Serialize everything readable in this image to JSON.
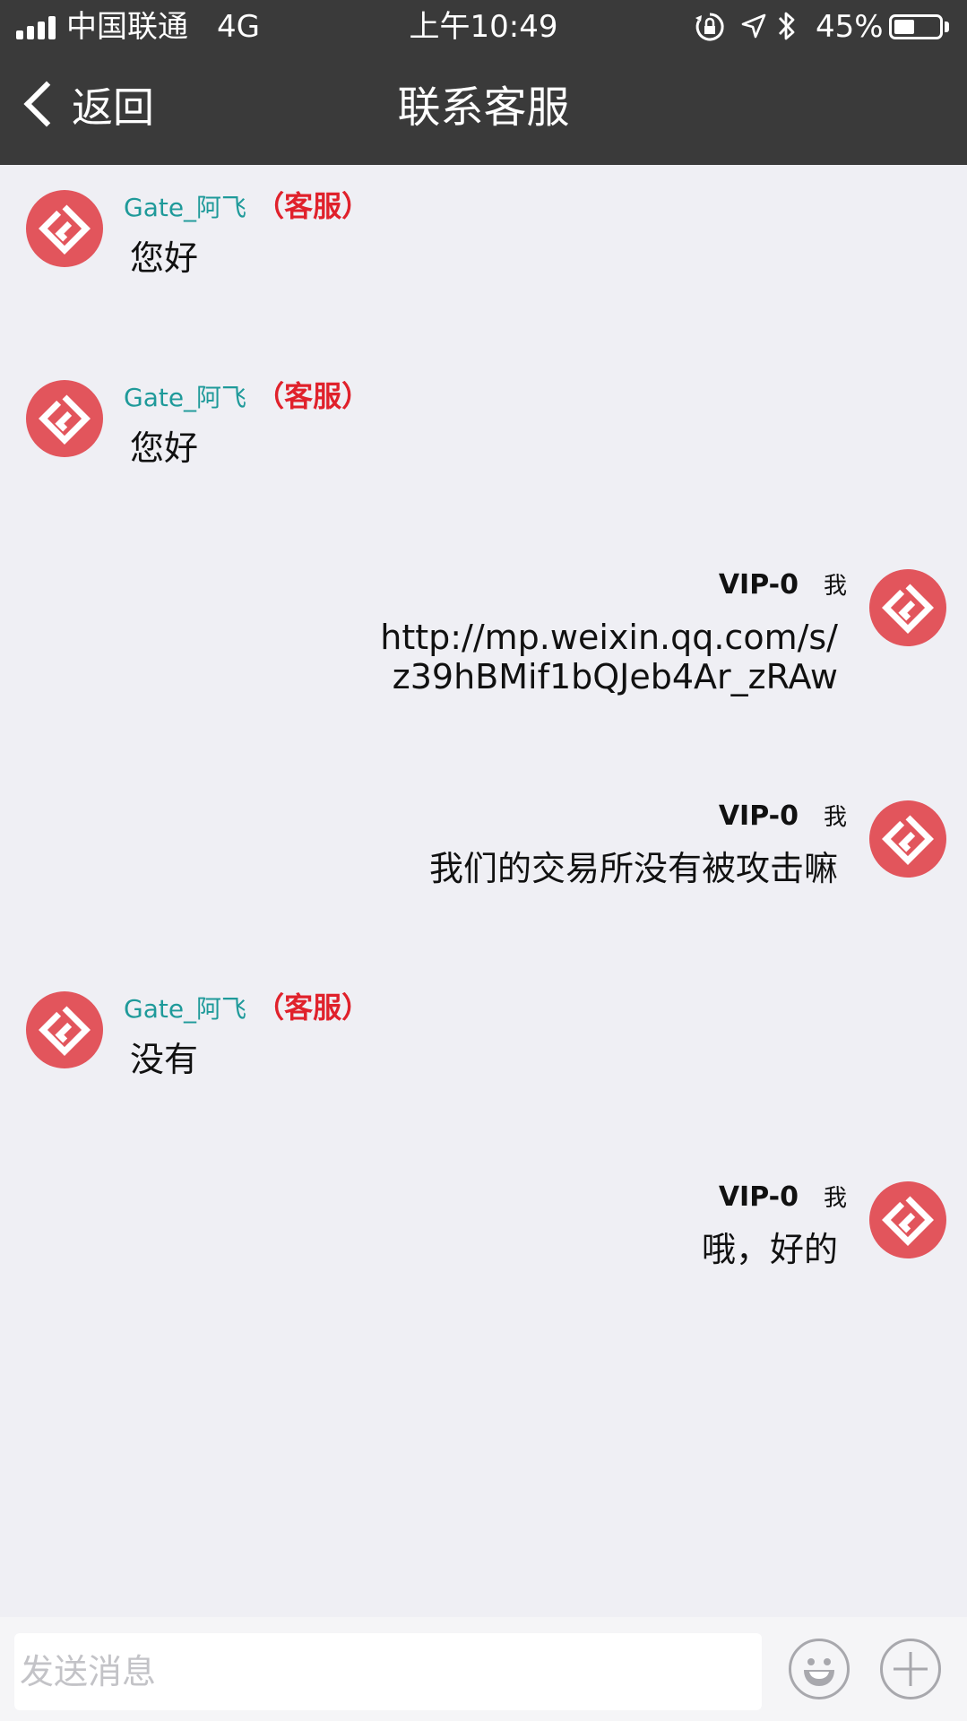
{
  "status_bar": {
    "carrier": "中国联通",
    "network": "4G",
    "time": "上午10:49",
    "battery_percent": "45%",
    "battery_level": 0.45
  },
  "nav": {
    "back_label": "返回",
    "title": "联系客服"
  },
  "messages": [
    {
      "side": "left",
      "name": "Gate_阿飞",
      "role": "（客服）",
      "text": "您好"
    },
    {
      "side": "left",
      "name": "Gate_阿飞",
      "role": "（客服）",
      "text": "您好"
    },
    {
      "side": "right",
      "name": "VIP-0",
      "me": "我",
      "text_line1": "http://mp.weixin.qq.com/s/",
      "text_line2": "z39hBMif1bQJeb4Ar_zRAw"
    },
    {
      "side": "right",
      "name": "VIP-0",
      "me": "我",
      "text": "我们的交易所没有被攻击嘛"
    },
    {
      "side": "left",
      "name": "Gate_阿飞",
      "role": "（客服）",
      "text": "没有"
    },
    {
      "side": "right",
      "name": "VIP-0",
      "me": "我",
      "text": "哦，好的"
    }
  ],
  "input": {
    "placeholder": "发送消息",
    "value": ""
  },
  "colors": {
    "bar_bg": "#3a3a3a",
    "chat_bg": "#efeff4",
    "avatar": "#e2555c",
    "agent_name": "#1f9a9a",
    "role_tag": "#e0212b"
  }
}
